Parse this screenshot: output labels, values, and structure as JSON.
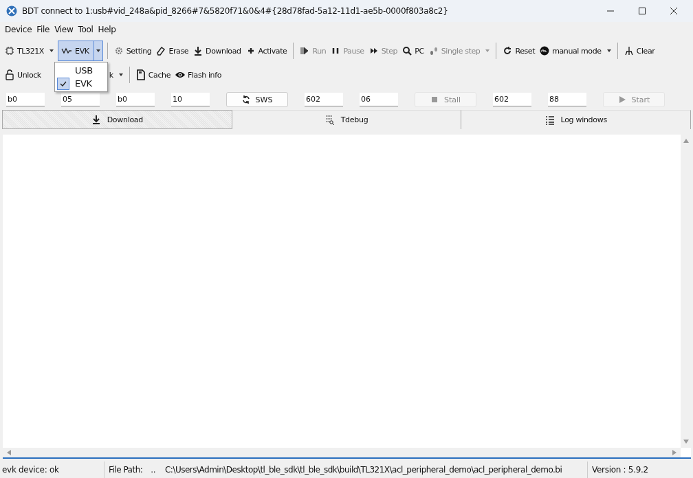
{
  "window": {
    "title": "BDT connect to 1:usb#vid_248a&pid_8266#7&5820f71&0&4#{28d78fad-5a12-11d1-ae5b-0000f803a8c2}"
  },
  "menu": [
    "Device",
    "File",
    "View",
    "Tool",
    "Help"
  ],
  "toolbar": [
    {
      "label": "TL321X",
      "kind": "dropdown",
      "disabled": false
    },
    {
      "label": "EVK",
      "kind": "split",
      "pressed": true
    },
    {
      "kind": "separator"
    },
    {
      "label": "Setting",
      "kind": "button",
      "disabled": false
    },
    {
      "label": "Erase",
      "kind": "button",
      "disabled": false
    },
    {
      "label": "Download",
      "kind": "button",
      "disabled": false
    },
    {
      "label": "Activate",
      "kind": "button",
      "disabled": false
    },
    {
      "kind": "separator"
    },
    {
      "label": "Run",
      "kind": "button",
      "disabled": true
    },
    {
      "label": "Pause",
      "kind": "button",
      "disabled": true
    },
    {
      "label": "Step",
      "kind": "button",
      "disabled": true
    },
    {
      "label": "PC",
      "kind": "button",
      "disabled": false
    },
    {
      "label": "Single step",
      "kind": "dropdown",
      "disabled": true
    },
    {
      "kind": "separator"
    },
    {
      "label": "Reset",
      "kind": "button",
      "disabled": false
    },
    {
      "label": "manual mode",
      "kind": "dropdown",
      "disabled": false
    },
    {
      "kind": "separator"
    },
    {
      "label": "Clear",
      "kind": "button",
      "disabled": false
    }
  ],
  "toolbar2": [
    {
      "label": "Unlock",
      "kind": "button"
    },
    {
      "label": "k",
      "kind": "dropdown"
    },
    {
      "kind": "separator"
    },
    {
      "label": "Cache",
      "kind": "button"
    },
    {
      "label": "Flash info",
      "kind": "button"
    }
  ],
  "dropdown_menu": [
    {
      "label": "USB",
      "checked": false
    },
    {
      "label": "EVK",
      "checked": true
    }
  ],
  "fields_row": [
    {
      "kind": "field",
      "value": "b0"
    },
    {
      "kind": "field",
      "value": "05"
    },
    {
      "kind": "field",
      "value": "b0"
    },
    {
      "kind": "field",
      "value": "10"
    },
    {
      "kind": "button",
      "label": "SWS",
      "disabled": false
    },
    {
      "kind": "field",
      "value": "602"
    },
    {
      "kind": "field",
      "value": "06"
    },
    {
      "kind": "button",
      "label": "Stall",
      "disabled": true
    },
    {
      "kind": "field",
      "value": "602"
    },
    {
      "kind": "field",
      "value": "88"
    },
    {
      "kind": "button",
      "label": "Start",
      "disabled": true
    }
  ],
  "tabs": [
    {
      "label": "Download",
      "selected": true
    },
    {
      "label": "Tdebug",
      "selected": false
    },
    {
      "label": "Log windows",
      "selected": false
    }
  ],
  "status_bar": {
    "device": "evk device: ok",
    "file_path_label": "File Path:",
    "ellipsis": "..",
    "file_path": "C:\\Users\\Admin\\Desktop\\tl_ble_sdk\\tl_ble_sdk\\build\\TL321X\\acl_peripheral_demo\\acl_peripheral_demo.bi",
    "version": "Version : 5.9.2"
  }
}
